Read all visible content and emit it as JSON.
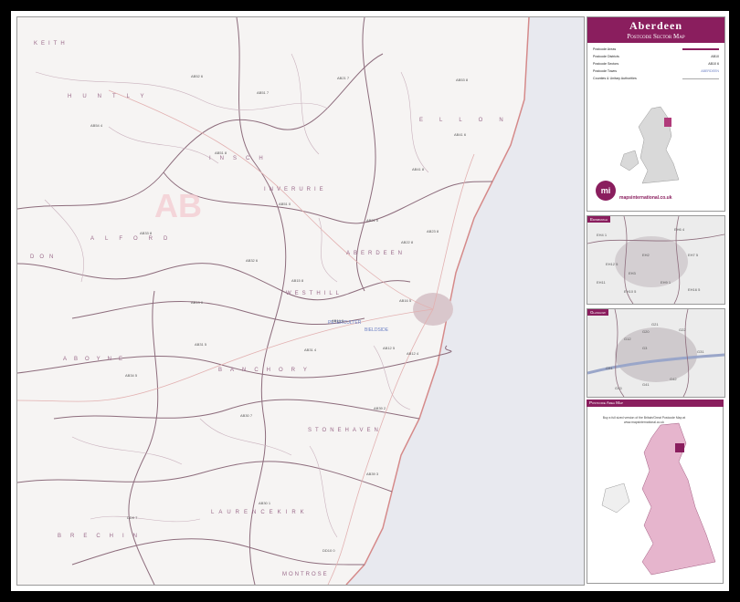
{
  "title": {
    "line1": "Aberdeen",
    "line2": "Postcode Sector Map"
  },
  "legend": [
    {
      "label": "Postcode Areas",
      "sample": "",
      "color": "#8a1e5e"
    },
    {
      "label": "Postcode Districts",
      "sample": "AB10",
      "color": "#8a1e5e"
    },
    {
      "label": "Postcode Sectors",
      "sample": "AB10 6",
      "color": "#c98aa8"
    },
    {
      "label": "Postcode Towns",
      "sample": "ABERDEEN",
      "color": "#6b7fc4"
    },
    {
      "label": "Counties & Unitary Authorities",
      "sample": "",
      "color": "#aaaaaa"
    }
  ],
  "brand": {
    "logo": "mi",
    "name": "mapsinternational.co.uk"
  },
  "insets": [
    {
      "title": "Edinburgh",
      "labels": [
        "EH4 1",
        "EH6 4",
        "EH7 5",
        "EH12 5",
        "EH2",
        "EH3",
        "EH9 1",
        "EH16 5",
        "EH10 5",
        "EH11"
      ]
    },
    {
      "title": "Glasgow",
      "labels": [
        "G21",
        "G22",
        "G31",
        "G3",
        "G51",
        "G42",
        "G41",
        "G43",
        "G12",
        "G20"
      ]
    }
  ],
  "area_map": {
    "title": "Postcode Area Map",
    "promo": "Buy a full sized version of the Britain/Great Postcode Map at www.mapsinternational.co.uk"
  },
  "map": {
    "area_code": "AB",
    "regions": [
      "KEITH",
      "HUNTLY",
      "INSCH",
      "INVERURIE",
      "ELLON",
      "ALFORD",
      "DON",
      "WESTHILL",
      "ABERDEEN",
      "ABOYNE",
      "BANCHORY",
      "STONEHAVEN",
      "LAURENCEKIRK",
      "BRECHIN",
      "MONTROSE"
    ],
    "towns": [
      "PETERCULTER",
      "BIELDSIDE"
    ],
    "sectors": [
      "AB54 4",
      "AB52 6",
      "AB51 8",
      "AB51 0",
      "AB33 8",
      "AB51 7",
      "AB41 8",
      "AB21 0",
      "AB23 8",
      "AB15 8",
      "AB32 6",
      "AB31 4",
      "AB31 5",
      "AB34 5",
      "AB39 2",
      "AB39 3",
      "AB30 1",
      "AB30 7",
      "DD9 7",
      "DD10 0",
      "AB12 5",
      "AB12 4",
      "AB14 0",
      "AB13 0",
      "AB53 8",
      "AB41 6",
      "AB21 7",
      "AB22 8",
      "AB16 5"
    ]
  }
}
